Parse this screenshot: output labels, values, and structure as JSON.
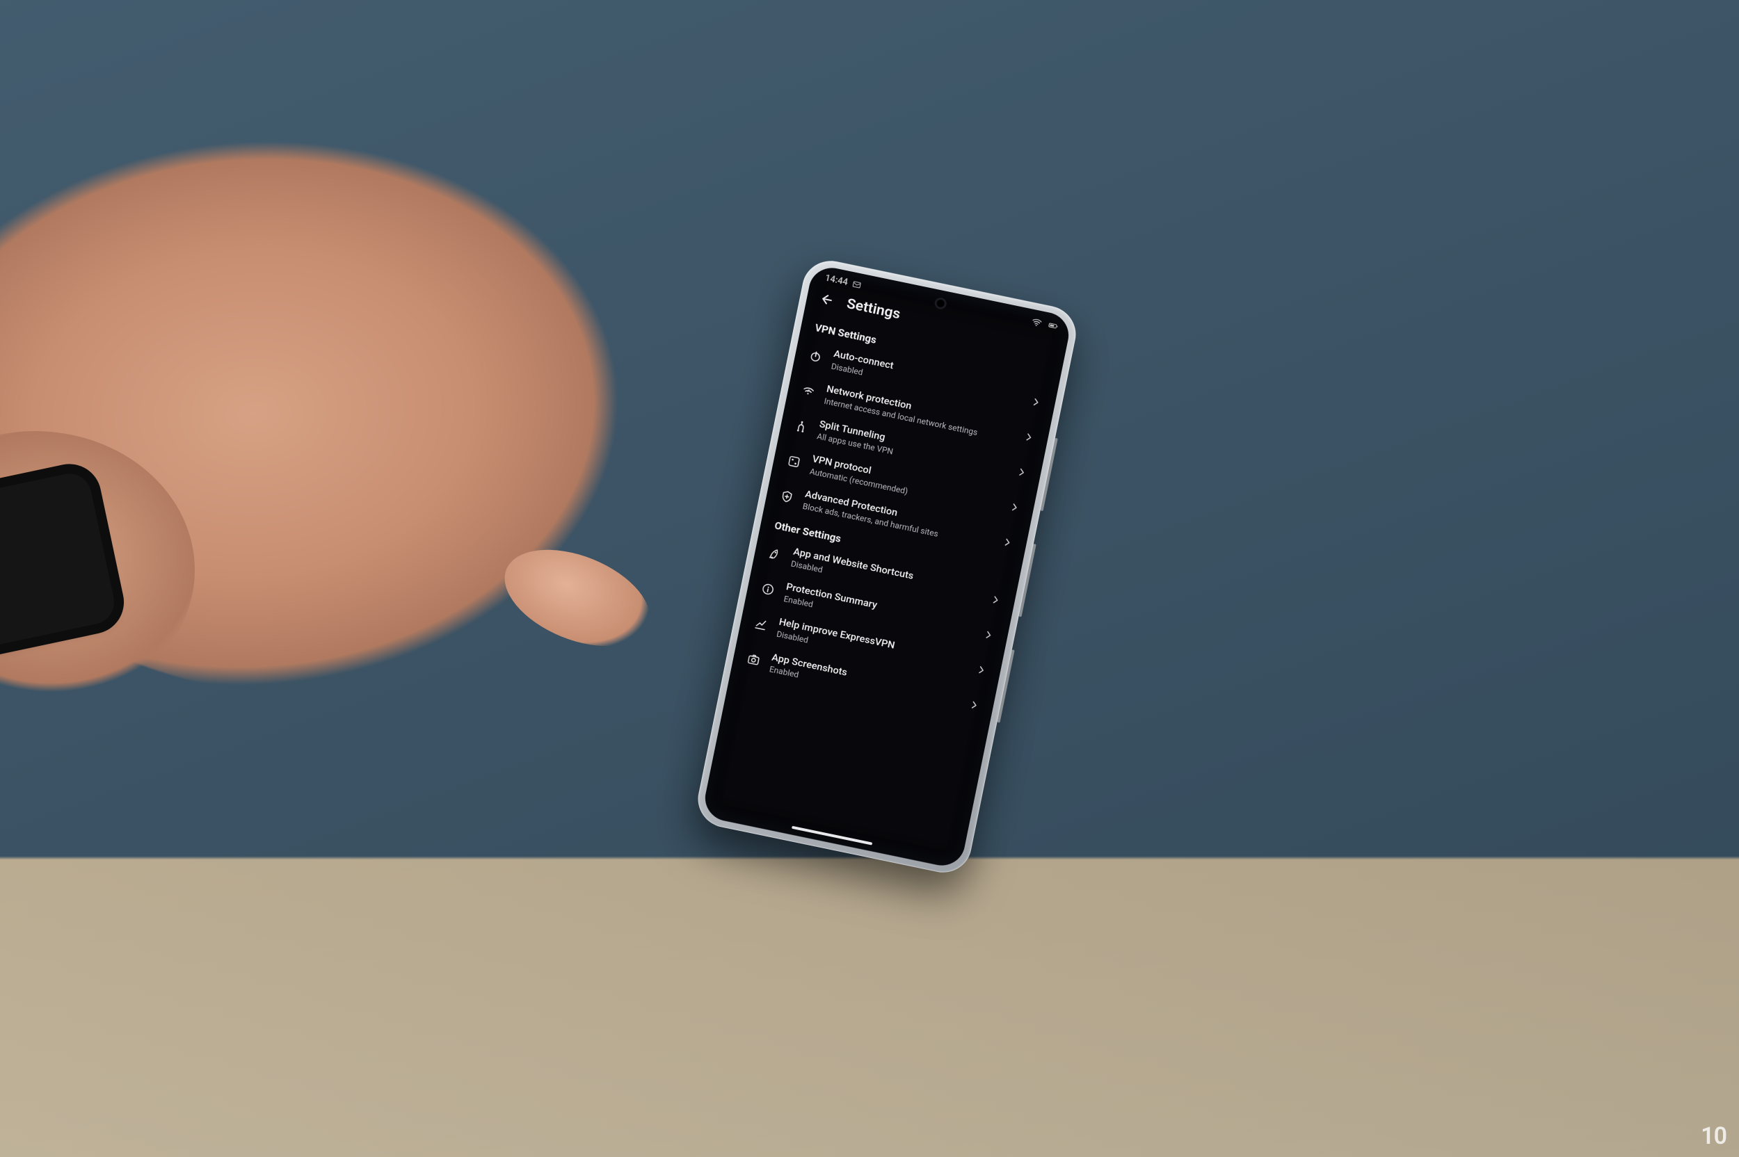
{
  "watermark": "10",
  "status": {
    "time": "14:44",
    "left_icon": "mail-icon"
  },
  "header": {
    "title": "Settings"
  },
  "sections": [
    {
      "title": "VPN Settings",
      "rows": [
        {
          "icon": "power-icon",
          "label": "Auto-connect",
          "sub": "Disabled"
        },
        {
          "icon": "wifi-shield-icon",
          "label": "Network protection",
          "sub": "Internet access and local network settings"
        },
        {
          "icon": "split-icon",
          "label": "Split Tunneling",
          "sub": "All apps use the VPN"
        },
        {
          "icon": "protocol-icon",
          "label": "VPN protocol",
          "sub": "Automatic (recommended)"
        },
        {
          "icon": "shield-plus-icon",
          "label": "Advanced Protection",
          "sub": "Block ads, trackers, and harmful sites"
        }
      ]
    },
    {
      "title": "Other Settings",
      "rows": [
        {
          "icon": "rocket-icon",
          "label": "App and Website Shortcuts",
          "sub": "Disabled"
        },
        {
          "icon": "info-icon",
          "label": "Protection Summary",
          "sub": "Enabled"
        },
        {
          "icon": "chart-icon",
          "label": "Help improve ExpressVPN",
          "sub": "Disabled"
        },
        {
          "icon": "camera-icon",
          "label": "App Screenshots",
          "sub": "Enabled"
        }
      ]
    }
  ]
}
